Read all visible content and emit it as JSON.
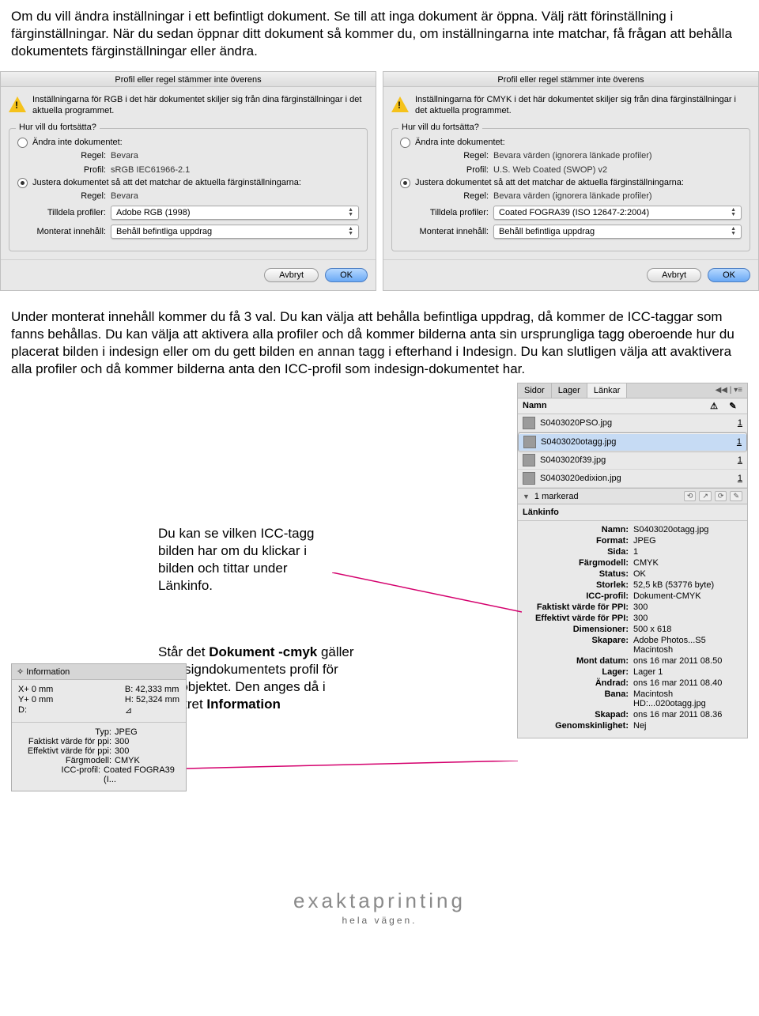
{
  "intro_text": "Om du vill ändra inställningar i ett befintligt dokument. Se till att inga dokument är öppna. Välj rätt förinställning i färginställningar. När du sedan öppnar ditt dokument så kommer du, om inställningarna inte matchar, få frågan att behålla dokumentets färginställningar eller ändra.",
  "dialog": {
    "title": "Profil eller regel stämmer inte överens",
    "group_label": "Hur vill du fortsätta?",
    "opt1_label": "Ändra inte dokumentet:",
    "regel_k": "Regel:",
    "profil_k": "Profil:",
    "opt2_label": "Justera dokumentet så att det matchar de aktuella färginställningarna:",
    "tilldela_k": "Tilldela profiler:",
    "monterat_k": "Monterat innehåll:",
    "cancel": "Avbryt",
    "ok": "OK",
    "left": {
      "warn": "Inställningarna för RGB i det här dokumentet skiljer sig från dina färginställningar i det aktuella programmet.",
      "regel1": "Bevara",
      "profil1": "sRGB IEC61966-2.1",
      "regel2": "Bevara",
      "tilldela": "Adobe RGB (1998)",
      "monterat": "Behåll befintliga uppdrag"
    },
    "right": {
      "warn": "Inställningarna för CMYK i det här dokumentet skiljer sig från dina färginställningar i det aktuella programmet.",
      "regel1": "Bevara värden (ignorera länkade profiler)",
      "profil1": "U.S. Web Coated (SWOP) v2",
      "regel2": "Bevara värden (ignorera länkade profiler)",
      "tilldela": "Coated FOGRA39 (ISO 12647-2:2004)",
      "monterat": "Behåll befintliga uppdrag"
    }
  },
  "para2": "Under monterat innehåll kommer du få 3 val. Du kan välja att behålla befintliga uppdrag, då kommer de ICC-taggar som fanns behållas. Du kan välja att aktivera alla profiler och då kommer bilderna anta sin ursprungliga tagg oberoende hur du placerat bilden i indesign eller om du gett bilden en annan tagg i efterhand i Indesign. Du kan slutligen välja att avaktivera alla profiler och då kommer bilderna anta den ICC-profil som indesign-dokumentet har.",
  "links_panel": {
    "tabs": [
      "Sidor",
      "Lager",
      "Länkar"
    ],
    "active_tab": "Länkar",
    "header_name": "Namn",
    "header_warn": "⚠",
    "header_count": "✎",
    "rows": [
      {
        "fn": "S0403020PSO.jpg",
        "ct": "1"
      },
      {
        "fn": "S0403020otagg.jpg",
        "ct": "1"
      },
      {
        "fn": "S0403020f39.jpg",
        "ct": "1"
      },
      {
        "fn": "S0403020edixion.jpg",
        "ct": "1"
      }
    ],
    "marker": "1 markerad",
    "linkinfo_title": "Länkinfo",
    "info": {
      "Namn": "S0403020otagg.jpg",
      "Format": "JPEG",
      "Sida": "1",
      "Färgmodell": "CMYK",
      "Status": "OK",
      "Storlek": "52,5 kB (53776 byte)",
      "ICC-profil": "Dokument-CMYK",
      "Faktiskt_varde_for_PPI": "300",
      "Effektivt_varde_for_PPI": "300",
      "Dimensioner": "500 x 618",
      "Skapare": "Adobe Photos...S5 Macintosh",
      "Mont_datum": "ons 16 mar 2011 08.50",
      "Lager": "Lager 1",
      "Andrad": "ons 16 mar 2011 08.40",
      "Bana": "Macintosh HD:...020otagg.jpg",
      "Skapad": "ons 16 mar 2011 08.36",
      "Genomskinlighet": "Nej"
    }
  },
  "callout1": "Du kan se vilken ICC-tagg bilden har om du klickar i bilden och tittar under Länkinfo.",
  "callout2_a": "Står det ",
  "callout2_b": "Dokument -cmyk",
  "callout2_c": " gäller Indesigndokumentets profil för det objektet. Den anges då i fönstret ",
  "callout2_d": "Information",
  "infopanel": {
    "title": "✧ Information",
    "x": "X+ 0 mm",
    "y": "Y+ 0 mm",
    "d": "D:",
    "b": "B: 42,333 mm",
    "h": "H: 52,324 mm",
    "tri": "⊿",
    "list": {
      "Typ": "JPEG",
      "Faktiskt_varde_for_ppi": "300",
      "Effektivt_varde_for_ppi": "300",
      "Fargmodell": "CMYK",
      "ICC_profil": "Coated FOGRA39 (I..."
    }
  },
  "footer": {
    "brand": "exaktaprinting",
    "slogan": "hela vägen."
  }
}
